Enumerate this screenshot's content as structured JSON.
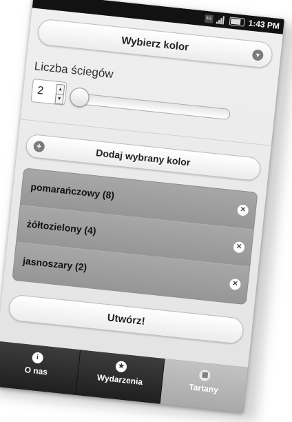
{
  "status_bar": {
    "network_label": "3G",
    "time": "1:43 PM"
  },
  "color_select": {
    "label": "Wybierz kolor",
    "icon": "chevron-down-icon"
  },
  "stitches": {
    "label": "Liczba ściegów",
    "value": "2",
    "slider_level": 0
  },
  "add_button": {
    "label": "Dodaj wybrany kolor",
    "icon": "plus-icon"
  },
  "colors_list": [
    {
      "label": "pomarańczowy (8)"
    },
    {
      "label": "żółtozielony (4)"
    },
    {
      "label": "jasnoszary (2)"
    }
  ],
  "create_button": {
    "label": "Utwórz!"
  },
  "tabs": [
    {
      "label": "O nas",
      "icon": "info-icon",
      "glyph": "i",
      "active": false
    },
    {
      "label": "Wydarzenia",
      "icon": "star-icon",
      "glyph": "★",
      "active": false
    },
    {
      "label": "Tartany",
      "icon": "grid-icon",
      "glyph": "▦",
      "active": true
    }
  ]
}
